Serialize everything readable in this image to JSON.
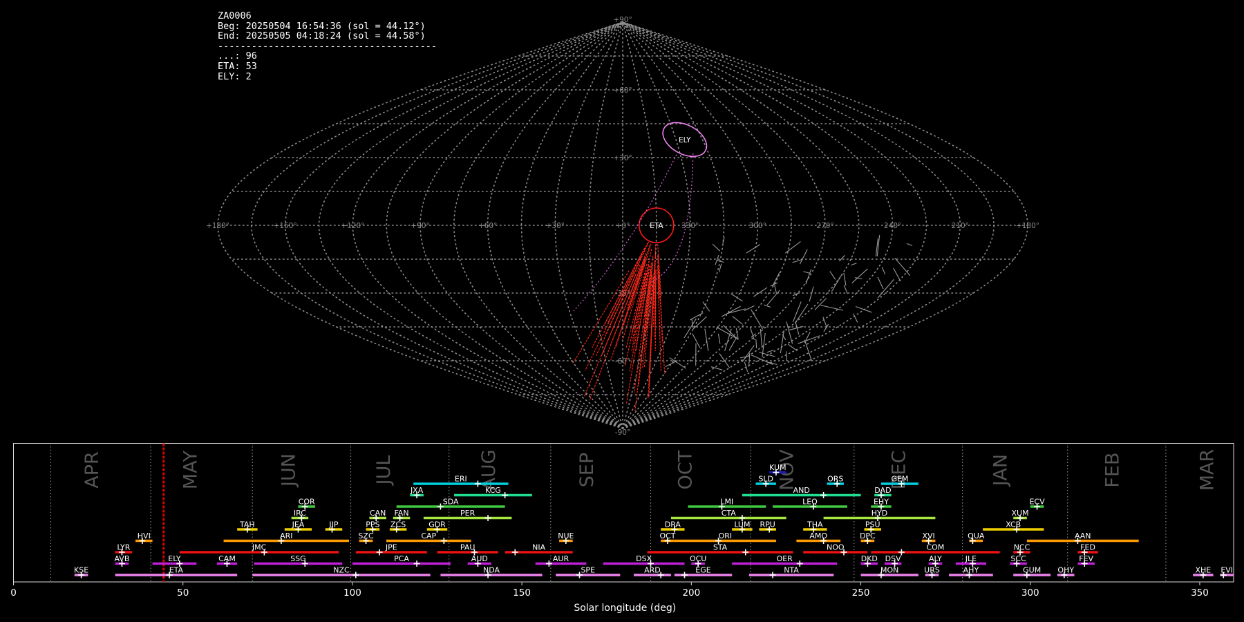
{
  "info": {
    "lines": [
      "ZA0006",
      "Beg: 20250504 16:54:36 (sol = 44.12°)",
      "End: 20250505 04:18:24 (sol = 44.58°)",
      "---------------------------------------",
      "...: 96",
      "ETA: 53",
      "ELY: 2"
    ]
  },
  "sky_map": {
    "projection": "sinusoidal",
    "lat_labels": [
      "+90°",
      "+60°",
      "+30°",
      "-30°",
      "-60°",
      "-90°"
    ],
    "lon_labels": [
      "+180°",
      "+150°",
      "+120°",
      "+90°",
      "+60°",
      "+30°",
      "+0°",
      "330°",
      "300°",
      "270°",
      "240°",
      "210°",
      "+180°"
    ],
    "radiants": [
      {
        "code": "ETA",
        "lon": -15,
        "lat": 0,
        "color": "#ff1a1a",
        "shape": "circle"
      },
      {
        "code": "ELY",
        "lon": -35,
        "lat": 38,
        "color": "#ee82ee",
        "shape": "ellipse"
      }
    ],
    "colors": {
      "grid": "#8c8c8c",
      "eta_tracks": "#ff2a1a",
      "ely_tracks": "#dd66dd",
      "other_tracks": "#9a9a9a"
    }
  },
  "chart_data": {
    "type": "timeline",
    "xlabel": "Solar longitude (deg)",
    "xlim": [
      0,
      360
    ],
    "xticks": [
      0,
      50,
      100,
      150,
      200,
      250,
      300,
      350
    ],
    "month_boundaries": [
      11,
      40.5,
      70.5,
      99.5,
      128.5,
      158.5,
      188,
      217.5,
      248,
      280,
      311,
      340
    ],
    "months": [
      {
        "name": "APR",
        "sol": 25
      },
      {
        "name": "MAY",
        "sol": 54
      },
      {
        "name": "JUN",
        "sol": 83
      },
      {
        "name": "JUL",
        "sol": 111
      },
      {
        "name": "AUG",
        "sol": 142
      },
      {
        "name": "SEP",
        "sol": 171
      },
      {
        "name": "OCT",
        "sol": 200
      },
      {
        "name": "NOV",
        "sol": 230
      },
      {
        "name": "DEC",
        "sol": 263
      },
      {
        "name": "JAN",
        "sol": 293
      },
      {
        "name": "FEB",
        "sol": 326
      },
      {
        "name": "MAR",
        "sol": 354
      }
    ],
    "current_sol": 44.3,
    "showers": [
      {
        "code": "KSE",
        "start": 18,
        "end": 22,
        "peak": 20,
        "row": 0,
        "color": "#ee82ee"
      },
      {
        "code": "ETA",
        "start": 30,
        "end": 66,
        "peak": 46,
        "row": 0,
        "color": "#ee82ee"
      },
      {
        "code": "NZC",
        "start": 70.5,
        "end": 123,
        "peak": 101,
        "row": 0,
        "color": "#ee82ee"
      },
      {
        "code": "NDA",
        "start": 126,
        "end": 156,
        "peak": 140,
        "row": 0,
        "color": "#ee82ee"
      },
      {
        "code": "SPE",
        "start": 160,
        "end": 179,
        "peak": 167,
        "row": 0,
        "color": "#ee82ee"
      },
      {
        "code": "ARD",
        "start": 183,
        "end": 194,
        "peak": 191,
        "row": 0,
        "color": "#ee82ee"
      },
      {
        "code": "EGE",
        "start": 195,
        "end": 212,
        "peak": 198,
        "row": 0,
        "color": "#ee82ee"
      },
      {
        "code": "NTA",
        "start": 217,
        "end": 242,
        "peak": 224,
        "row": 0,
        "color": "#ee82ee"
      },
      {
        "code": "MON",
        "start": 250,
        "end": 267,
        "peak": 256,
        "row": 0,
        "color": "#ee82ee"
      },
      {
        "code": "URS",
        "start": 269,
        "end": 273,
        "peak": 271,
        "row": 0,
        "color": "#ee82ee"
      },
      {
        "code": "AHY",
        "start": 276,
        "end": 289,
        "peak": 282,
        "row": 0,
        "color": "#ee82ee"
      },
      {
        "code": "GUM",
        "start": 295,
        "end": 306,
        "peak": 299,
        "row": 0,
        "color": "#ee82ee"
      },
      {
        "code": "OHY",
        "start": 308,
        "end": 313,
        "peak": 310,
        "row": 0,
        "color": "#ee82ee"
      },
      {
        "code": "XHE",
        "start": 348,
        "end": 354,
        "peak": 351,
        "row": 0,
        "color": "#ee82ee"
      },
      {
        "code": "EVI",
        "start": 356,
        "end": 360,
        "peak": 357,
        "row": 0,
        "color": "#ee82ee"
      },
      {
        "code": "AVB",
        "start": 30,
        "end": 34,
        "peak": 32,
        "row": 1,
        "color": "#c020d8"
      },
      {
        "code": "ELY",
        "start": 41,
        "end": 54,
        "peak": 49,
        "row": 1,
        "color": "#c020d8"
      },
      {
        "code": "CAM",
        "start": 60,
        "end": 66,
        "peak": 63,
        "row": 1,
        "color": "#c020d8"
      },
      {
        "code": "SSG",
        "start": 71,
        "end": 97,
        "peak": 86,
        "row": 1,
        "color": "#c020d8"
      },
      {
        "code": "PCA",
        "start": 100,
        "end": 129,
        "peak": 119,
        "row": 1,
        "color": "#c020d8"
      },
      {
        "code": "AUD",
        "start": 134,
        "end": 141,
        "peak": 137,
        "row": 1,
        "color": "#c020d8"
      },
      {
        "code": "AUR",
        "start": 154,
        "end": 169,
        "peak": 158,
        "row": 1,
        "color": "#c020d8"
      },
      {
        "code": "DSX",
        "start": 174,
        "end": 198,
        "peak": 188,
        "row": 1,
        "color": "#c020d8"
      },
      {
        "code": "OCU",
        "start": 200,
        "end": 204,
        "peak": 202,
        "row": 1,
        "color": "#c020d8"
      },
      {
        "code": "OER",
        "start": 212,
        "end": 243,
        "peak": 232,
        "row": 1,
        "color": "#c020d8"
      },
      {
        "code": "DKD",
        "start": 250,
        "end": 255,
        "peak": 252,
        "row": 1,
        "color": "#c020d8"
      },
      {
        "code": "DSV",
        "start": 257,
        "end": 262,
        "peak": 260,
        "row": 1,
        "color": "#c020d8"
      },
      {
        "code": "ALY",
        "start": 270,
        "end": 274,
        "peak": 272,
        "row": 1,
        "color": "#c020d8"
      },
      {
        "code": "JLE",
        "start": 278,
        "end": 287,
        "peak": 283,
        "row": 1,
        "color": "#c020d8"
      },
      {
        "code": "SCC",
        "start": 294,
        "end": 299,
        "peak": 296,
        "row": 1,
        "color": "#c020d8"
      },
      {
        "code": "FEV",
        "start": 314,
        "end": 319,
        "peak": 316,
        "row": 1,
        "color": "#c020d8"
      },
      {
        "code": "LYR",
        "start": 30,
        "end": 35,
        "peak": 32,
        "row": 2,
        "color": "#ee1111"
      },
      {
        "code": "JMC",
        "start": 49,
        "end": 96,
        "peak": 74,
        "row": 2,
        "color": "#ee1111"
      },
      {
        "code": "JPE",
        "start": 101,
        "end": 122,
        "peak": 108,
        "row": 2,
        "color": "#ee1111"
      },
      {
        "code": "PAU",
        "start": 125,
        "end": 143,
        "peak": 136,
        "row": 2,
        "color": "#ee1111"
      },
      {
        "code": "NIA",
        "start": 145,
        "end": 165,
        "peak": 148,
        "row": 2,
        "color": "#ee1111"
      },
      {
        "code": "STA",
        "start": 187,
        "end": 230,
        "peak": 216,
        "row": 2,
        "color": "#ee1111"
      },
      {
        "code": "NOO",
        "start": 233,
        "end": 252,
        "peak": 245,
        "row": 2,
        "color": "#ee1111"
      },
      {
        "code": "COM",
        "start": 253,
        "end": 291,
        "peak": 262,
        "row": 2,
        "color": "#ee1111"
      },
      {
        "code": "NCC",
        "start": 295,
        "end": 300,
        "peak": 297,
        "row": 2,
        "color": "#ee1111"
      },
      {
        "code": "FED",
        "start": 314,
        "end": 320,
        "peak": 316,
        "row": 2,
        "color": "#ee1111"
      },
      {
        "code": "HVI",
        "start": 36,
        "end": 41,
        "peak": 38,
        "row": 3,
        "color": "#ff9a00"
      },
      {
        "code": "ARI",
        "start": 62,
        "end": 99,
        "peak": 79,
        "row": 3,
        "color": "#ff9a00"
      },
      {
        "code": "SZC",
        "start": 102,
        "end": 106,
        "peak": 104,
        "row": 3,
        "color": "#ff9a00"
      },
      {
        "code": "CAP",
        "start": 110,
        "end": 135,
        "peak": 127,
        "row": 3,
        "color": "#ff9a00"
      },
      {
        "code": "NUE",
        "start": 161,
        "end": 165,
        "peak": 163,
        "row": 3,
        "color": "#ff9a00"
      },
      {
        "code": "OCT",
        "start": 191,
        "end": 195,
        "peak": 193,
        "row": 3,
        "color": "#ff9a00"
      },
      {
        "code": "ORI",
        "start": 195,
        "end": 225,
        "peak": 208,
        "row": 3,
        "color": "#ff9a00"
      },
      {
        "code": "AMO",
        "start": 231,
        "end": 244,
        "peak": 239,
        "row": 3,
        "color": "#ff9a00"
      },
      {
        "code": "DPC",
        "start": 250,
        "end": 254,
        "peak": 252,
        "row": 3,
        "color": "#ff9a00"
      },
      {
        "code": "XVI",
        "start": 268,
        "end": 272,
        "peak": 270,
        "row": 3,
        "color": "#ff9a00"
      },
      {
        "code": "QUA",
        "start": 282,
        "end": 286,
        "peak": 283,
        "row": 3,
        "color": "#ff9a00"
      },
      {
        "code": "AAN",
        "start": 299,
        "end": 332,
        "peak": 314,
        "row": 3,
        "color": "#ff9a00"
      },
      {
        "code": "TAH",
        "start": 66,
        "end": 72,
        "peak": 69,
        "row": 4,
        "color": "#f0d000"
      },
      {
        "code": "JEA",
        "start": 80,
        "end": 88,
        "peak": 84,
        "row": 4,
        "color": "#f0d000"
      },
      {
        "code": "JIP",
        "start": 92,
        "end": 97,
        "peak": 94,
        "row": 4,
        "color": "#f0d000"
      },
      {
        "code": "PPS",
        "start": 104,
        "end": 108,
        "peak": 106,
        "row": 4,
        "color": "#f0d000"
      },
      {
        "code": "ZCS",
        "start": 111,
        "end": 116,
        "peak": 113,
        "row": 4,
        "color": "#f0d000"
      },
      {
        "code": "GDR",
        "start": 122,
        "end": 128,
        "peak": 125,
        "row": 4,
        "color": "#f0d000"
      },
      {
        "code": "DRA",
        "start": 191,
        "end": 198,
        "peak": 195,
        "row": 4,
        "color": "#f0d000"
      },
      {
        "code": "LUM",
        "start": 212,
        "end": 218,
        "peak": 215,
        "row": 4,
        "color": "#f0d000"
      },
      {
        "code": "RPU",
        "start": 220,
        "end": 225,
        "peak": 223,
        "row": 4,
        "color": "#f0d000"
      },
      {
        "code": "THA",
        "start": 233,
        "end": 240,
        "peak": 236,
        "row": 4,
        "color": "#f0d000"
      },
      {
        "code": "PSU",
        "start": 251,
        "end": 256,
        "peak": 253,
        "row": 4,
        "color": "#f0d000"
      },
      {
        "code": "XCB",
        "start": 286,
        "end": 304,
        "peak": 296,
        "row": 4,
        "color": "#f0d000"
      },
      {
        "code": "IRC",
        "start": 82,
        "end": 87,
        "peak": 85,
        "row": 5,
        "color": "#a8e640"
      },
      {
        "code": "CAN",
        "start": 105,
        "end": 110,
        "peak": 107,
        "row": 5,
        "color": "#a8e640"
      },
      {
        "code": "FAN",
        "start": 112,
        "end": 117,
        "peak": 114,
        "row": 5,
        "color": "#a8e640"
      },
      {
        "code": "PER",
        "start": 121,
        "end": 147,
        "peak": 140,
        "row": 5,
        "color": "#a8e640"
      },
      {
        "code": "CTA",
        "start": 194,
        "end": 228,
        "peak": 215,
        "row": 5,
        "color": "#a8e640"
      },
      {
        "code": "HYD",
        "start": 239,
        "end": 272,
        "peak": 255,
        "row": 5,
        "color": "#a8e640"
      },
      {
        "code": "XUM",
        "start": 295,
        "end": 299,
        "peak": 297,
        "row": 5,
        "color": "#a8e640"
      },
      {
        "code": "COR",
        "start": 84,
        "end": 89,
        "peak": 86,
        "row": 6,
        "color": "#40c840"
      },
      {
        "code": "SDA",
        "start": 113,
        "end": 145,
        "peak": 126,
        "row": 6,
        "color": "#40c840"
      },
      {
        "code": "LMI",
        "start": 199,
        "end": 222,
        "peak": 209,
        "row": 6,
        "color": "#40c840"
      },
      {
        "code": "LEQ",
        "start": 224,
        "end": 246,
        "peak": 236,
        "row": 6,
        "color": "#40c840"
      },
      {
        "code": "EHY",
        "start": 253,
        "end": 259,
        "peak": 256,
        "row": 6,
        "color": "#40c840"
      },
      {
        "code": "ECV",
        "start": 300,
        "end": 304,
        "peak": 302,
        "row": 6,
        "color": "#40c840"
      },
      {
        "code": "JXA",
        "start": 117,
        "end": 121,
        "peak": 119,
        "row": 7,
        "color": "#20e090"
      },
      {
        "code": "KCG",
        "start": 130,
        "end": 153,
        "peak": 145,
        "row": 7,
        "color": "#20e090"
      },
      {
        "code": "AND",
        "start": 215,
        "end": 250,
        "peak": 239,
        "row": 7,
        "color": "#20e090"
      },
      {
        "code": "DAD",
        "start": 254,
        "end": 259,
        "peak": 256,
        "row": 7,
        "color": "#20e090"
      },
      {
        "code": "ERI",
        "start": 118,
        "end": 146,
        "peak": 137,
        "row": 8,
        "color": "#00d0e0"
      },
      {
        "code": "SLD",
        "start": 219,
        "end": 225,
        "peak": 222,
        "row": 8,
        "color": "#00d0e0"
      },
      {
        "code": "ORS",
        "start": 240,
        "end": 245,
        "peak": 243,
        "row": 8,
        "color": "#00d0e0"
      },
      {
        "code": "GEM",
        "start": 256,
        "end": 267,
        "peak": 262,
        "row": 8,
        "color": "#00d0e0"
      },
      {
        "code": "KUM",
        "start": 223,
        "end": 228,
        "peak": 225,
        "row": 9,
        "color": "#1a1ab0"
      }
    ]
  }
}
